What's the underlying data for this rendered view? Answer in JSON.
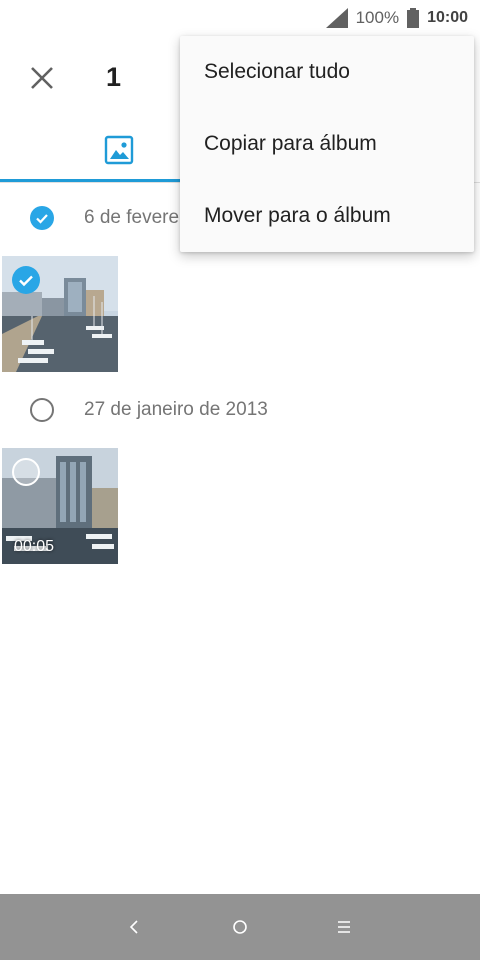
{
  "status_bar": {
    "battery_percent": "100%",
    "time": "10:00",
    "icons": [
      "cell-signal-icon",
      "battery-icon"
    ]
  },
  "toolbar": {
    "selected_count": "1",
    "close_icon": "close-icon"
  },
  "tabs": {
    "active_icon": "photos-icon"
  },
  "groups": [
    {
      "date": "6 de fevere",
      "checked": true,
      "items": [
        {
          "selected": true,
          "type": "photo"
        }
      ]
    },
    {
      "date": "27 de janeiro de 2013",
      "checked": false,
      "items": [
        {
          "selected": false,
          "type": "video",
          "duration": "00:05"
        }
      ]
    }
  ],
  "menu": {
    "items": [
      {
        "label": "Selecionar tudo"
      },
      {
        "label": "Copiar para álbum"
      },
      {
        "label": "Mover para o álbum"
      }
    ]
  },
  "nav_bar": {
    "icons": [
      "back-icon",
      "home-icon",
      "recents-icon"
    ]
  },
  "colors": {
    "accent": "#29a6e6",
    "tab_indicator": "#1f9bd7",
    "nav_bar": "#939393"
  }
}
